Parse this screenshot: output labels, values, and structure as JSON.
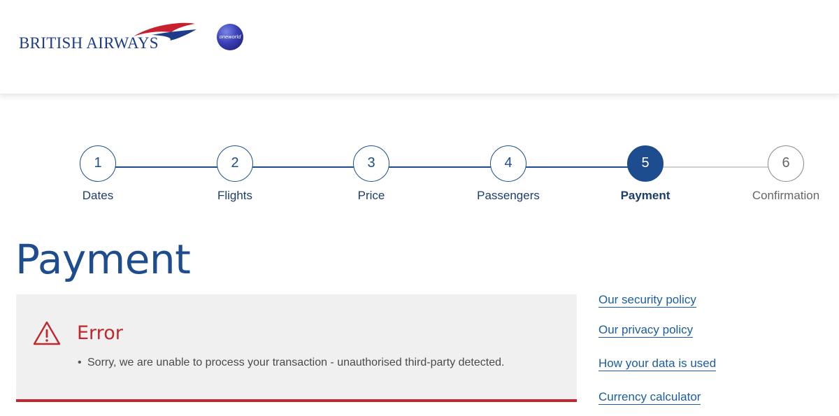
{
  "brand": {
    "name": "BRITISH AIRWAYS",
    "alliance": "oneworld"
  },
  "stepper": {
    "steps": [
      {
        "number": "1",
        "label": "Dates",
        "state": "complete"
      },
      {
        "number": "2",
        "label": "Flights",
        "state": "complete"
      },
      {
        "number": "3",
        "label": "Price",
        "state": "complete"
      },
      {
        "number": "4",
        "label": "Passengers",
        "state": "complete"
      },
      {
        "number": "5",
        "label": "Payment",
        "state": "active"
      },
      {
        "number": "6",
        "label": "Confirmation",
        "state": "future"
      }
    ]
  },
  "main": {
    "title": "Payment",
    "error": {
      "title": "Error",
      "messages": [
        "Sorry, we are unable to process your transaction - unauthorised third-party detected."
      ]
    }
  },
  "sidebar": {
    "links": [
      {
        "label": "Our security policy"
      },
      {
        "label": "Our privacy policy"
      },
      {
        "label": "How your data is used"
      },
      {
        "label": "Currency calculator"
      }
    ]
  },
  "colors": {
    "brand_blue": "#1d4d8f",
    "error_red": "#c0282d",
    "link_blue": "#1d5da0"
  }
}
